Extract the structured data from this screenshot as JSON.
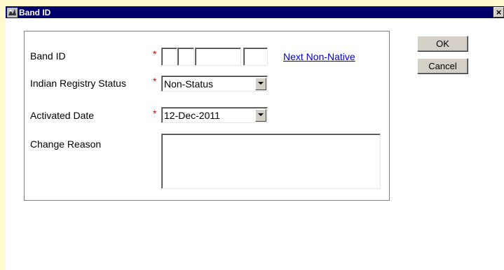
{
  "window": {
    "title": "Band ID",
    "close_glyph": "×"
  },
  "form": {
    "band_id": {
      "label": "Band ID",
      "required_mark": "*",
      "segments": [
        "",
        "",
        "",
        ""
      ]
    },
    "next_link": "Next Non-Native",
    "registry_status": {
      "label": "Indian Registry Status",
      "required_mark": "*",
      "value": "Non-Status"
    },
    "activated_date": {
      "label": "Activated Date",
      "required_mark": "*",
      "value": "12-Dec-2011"
    },
    "change_reason": {
      "label": "Change Reason",
      "value": ""
    }
  },
  "buttons": {
    "ok": "OK",
    "cancel": "Cancel"
  },
  "icons": {
    "app": "app-icon",
    "dropdown": "chevron-down-icon",
    "close": "close-icon"
  },
  "colors": {
    "titlebar": "#00006a",
    "required": "#e00000",
    "link": "#0000cc",
    "strip": "#fffacd"
  }
}
